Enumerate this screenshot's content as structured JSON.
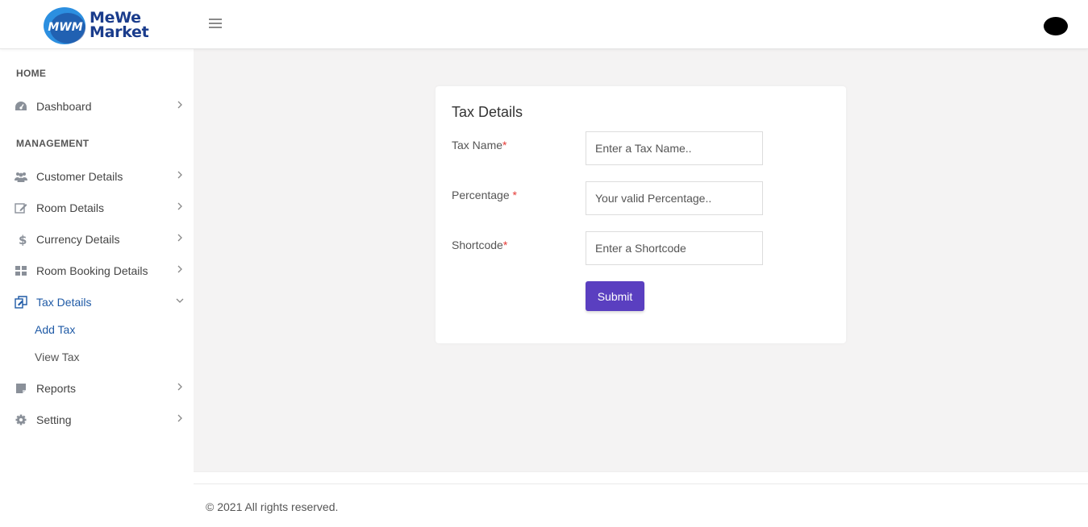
{
  "brand": {
    "line1": "MeWe",
    "line2": "Market",
    "mark_text": "MWM"
  },
  "sidebar": {
    "sections": [
      {
        "title": "HOME"
      },
      {
        "title": "MANAGEMENT"
      }
    ],
    "items": [
      {
        "label": "Dashboard",
        "icon": "dashboard-gauge-icon"
      },
      {
        "label": "Customer Details",
        "icon": "users-icon"
      },
      {
        "label": "Room Details",
        "icon": "edit-icon"
      },
      {
        "label": "Currency Details",
        "icon": "dollar-icon"
      },
      {
        "label": "Room Booking Details",
        "icon": "grid-icon"
      },
      {
        "label": "Tax Details",
        "icon": "copy-edit-icon"
      },
      {
        "label": "Reports",
        "icon": "note-icon"
      },
      {
        "label": "Setting",
        "icon": "gear-icon"
      }
    ],
    "subitems": [
      {
        "label": "Add Tax"
      },
      {
        "label": "View Tax"
      }
    ]
  },
  "form": {
    "title": "Tax Details",
    "fields": [
      {
        "label": "Tax Name",
        "required_mark": "*",
        "placeholder": "Enter a Tax Name..",
        "value": ""
      },
      {
        "label": "Percentage ",
        "required_mark": "*",
        "placeholder": "Your valid Percentage..",
        "value": ""
      },
      {
        "label": "Shortcode",
        "required_mark": "*",
        "placeholder": "Enter a Shortcode",
        "value": ""
      }
    ],
    "submit_label": "Submit"
  },
  "footer": {
    "text": "© 2021 All rights reserved."
  },
  "colors": {
    "accent": "#5a3fc0",
    "active_link": "#1f5aa6",
    "required": "#e53935",
    "brand_blue": "#1a3c8c"
  }
}
